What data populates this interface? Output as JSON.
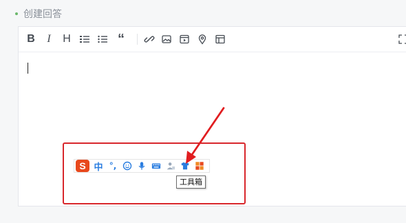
{
  "section": {
    "title": "创建回答"
  },
  "toolbar": {
    "bold_label": "B",
    "italic_label": "I",
    "heading_label": "H",
    "quote_label": "“"
  },
  "ime": {
    "logo_label": "S",
    "mode_label": "中",
    "punct_label": "°,",
    "tooltip": "工具箱"
  },
  "colors": {
    "annotation": "#d8262b",
    "ime_brand": "#e8491d",
    "ime_blue": "#2a7de0",
    "accent_dot": "#6bb86b"
  }
}
